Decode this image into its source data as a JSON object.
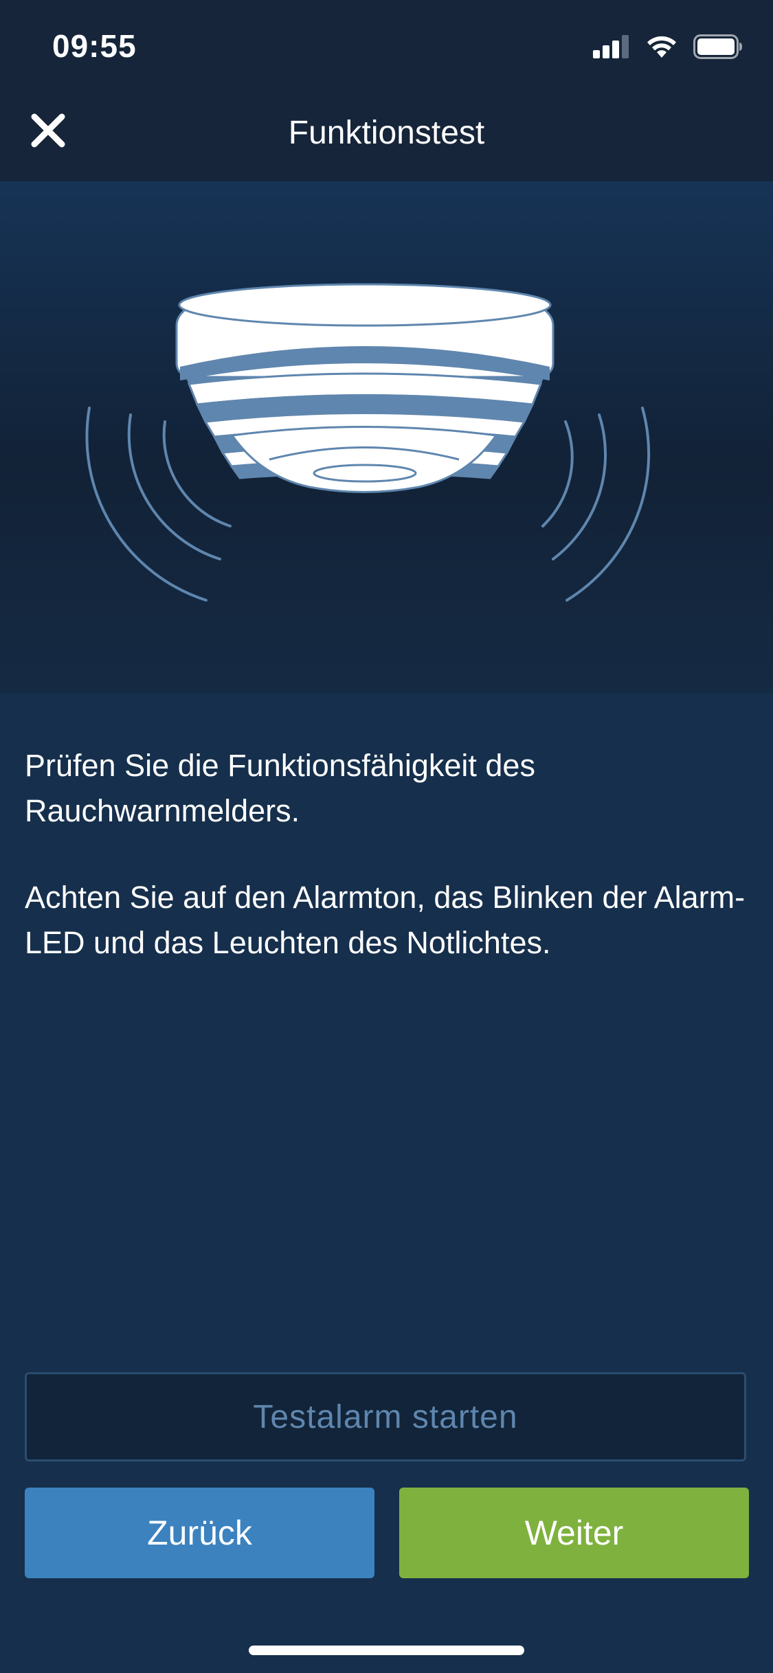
{
  "status_bar": {
    "time": "09:55"
  },
  "nav": {
    "title": "Funktionstest"
  },
  "content": {
    "paragraph_1": "Prüfen Sie die Funktionsfähigkeit des Rauchwarnmelders.",
    "paragraph_2": "Achten Sie auf den Alarmton, das Blinken der Alarm-LED und das Leuchten des Notlichtes."
  },
  "buttons": {
    "test_alarm": "Testalarm starten",
    "back": "Zurück",
    "next": "Weiter"
  },
  "colors": {
    "background": "#162f4c",
    "header": "#162539",
    "back_button": "#3b82bf",
    "next_button": "#7fb13e",
    "test_button_text": "#5f86ae"
  },
  "icons": {
    "close": "close-icon",
    "signal": "cellular-signal-icon",
    "wifi": "wifi-icon",
    "battery": "battery-icon",
    "illustration": "smoke-detector-icon"
  }
}
